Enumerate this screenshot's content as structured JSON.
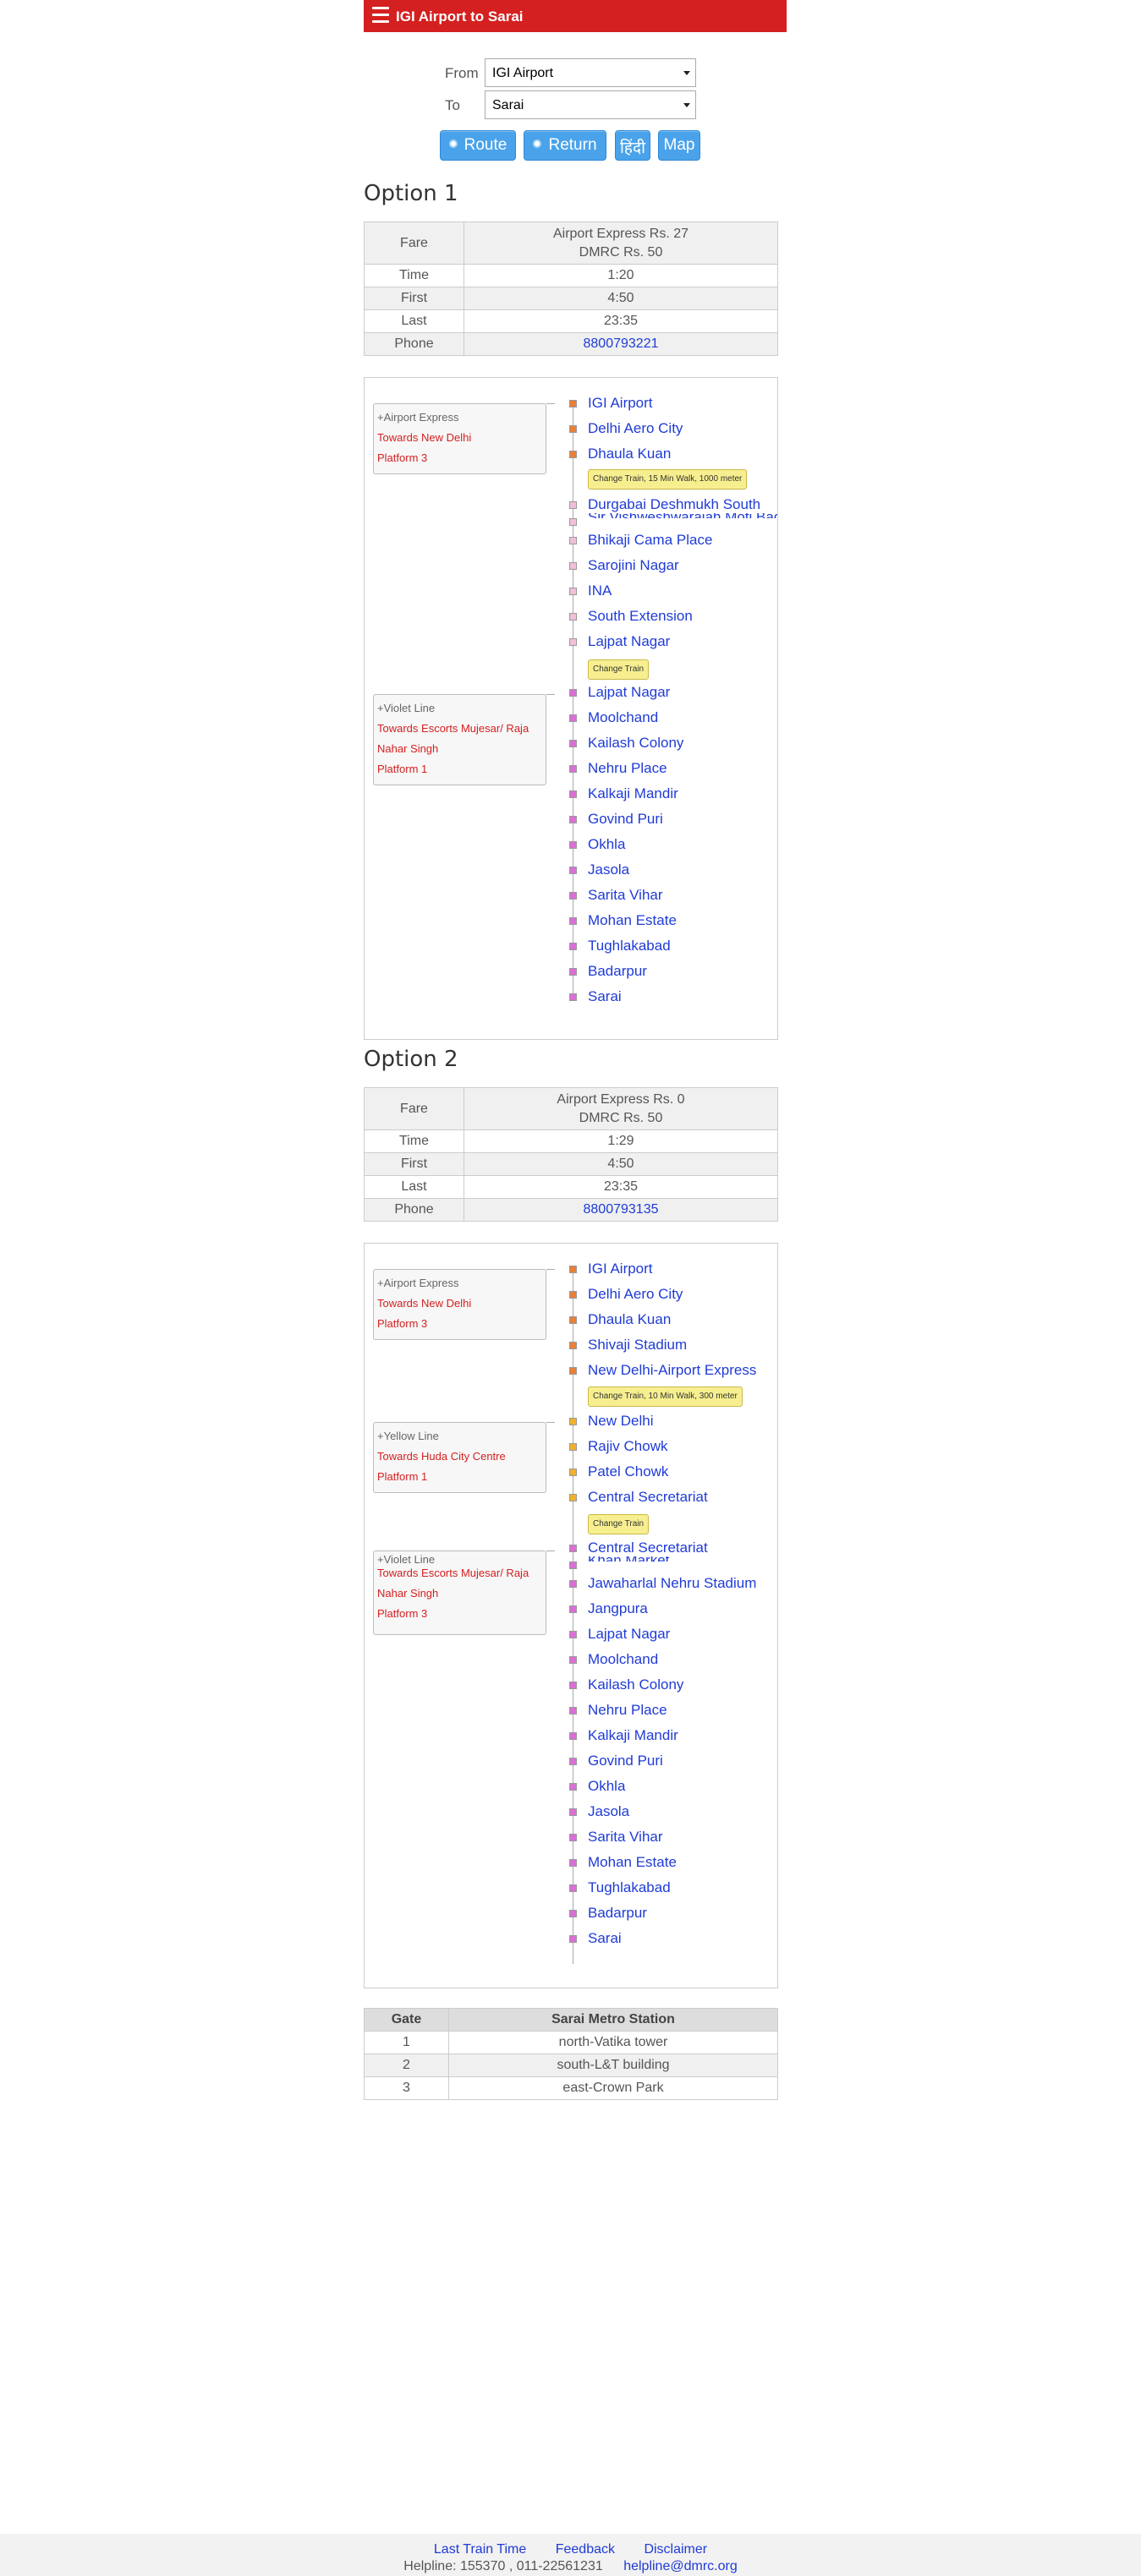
{
  "header": {
    "title": "IGI Airport to Sarai"
  },
  "form": {
    "from_label": "From",
    "from_value": "IGI Airport",
    "to_label": "To",
    "to_value": "Sarai",
    "buttons": {
      "route": "Route",
      "return": "Return",
      "hindi": "हिंदी",
      "map": "Map"
    }
  },
  "option1": {
    "heading": "Option 1",
    "fare_label": "Fare",
    "fare_line1": "Airport Express Rs. 27",
    "fare_line2": "DMRC Rs. 50",
    "rows": [
      {
        "label": "Time",
        "value": "1:20"
      },
      {
        "label": "First",
        "value": "4:50"
      },
      {
        "label": "Last",
        "value": "23:35"
      },
      {
        "label": "Phone",
        "value": "8800793221"
      }
    ],
    "lines": [
      {
        "name": "+Airport Express",
        "towards": "Towards New Delhi",
        "platform": "Platform 3"
      },
      {
        "name": "+Violet Line",
        "towards": "Towards Escorts Mujesar/ Raja Nahar Singh",
        "platform": "Platform 1"
      }
    ],
    "stations": [
      "IGI Airport",
      "Delhi Aero City",
      "Dhaula Kuan",
      "Durgabai Deshmukh South",
      "Sir Vishweshwaraiah Moti Bagh",
      "Bhikaji Cama Place",
      "Sarojini Nagar",
      "INA",
      "South Extension",
      "Lajpat Nagar",
      "Lajpat Nagar",
      "Moolchand",
      "Kailash Colony",
      "Nehru Place",
      "Kalkaji Mandir",
      "Govind Puri",
      "Okhla",
      "Jasola",
      "Sarita Vihar",
      "Mohan Estate",
      "Tughlakabad",
      "Badarpur",
      "Sarai"
    ],
    "tips": [
      "Change Train, 15 Min Walk, 1000 meter",
      "Change Train"
    ]
  },
  "option2": {
    "heading": "Option 2",
    "fare_label": "Fare",
    "fare_line1": "Airport Express Rs. 0",
    "fare_line2": "DMRC Rs. 50",
    "rows": [
      {
        "label": "Time",
        "value": "1:29"
      },
      {
        "label": "First",
        "value": "4:50"
      },
      {
        "label": "Last",
        "value": "23:35"
      },
      {
        "label": "Phone",
        "value": "8800793135"
      }
    ],
    "lines": [
      {
        "name": "+Airport Express",
        "towards": "Towards New Delhi",
        "platform": "Platform 3"
      },
      {
        "name": "+Yellow Line",
        "towards": "Towards Huda City Centre",
        "platform": "Platform 1"
      },
      {
        "name": "+Violet Line",
        "towards": "Towards Escorts Mujesar/ Raja Nahar Singh",
        "platform": "Platform 3"
      }
    ],
    "stations": [
      "IGI Airport",
      "Delhi Aero City",
      "Dhaula Kuan",
      "Shivaji Stadium",
      "New Delhi-Airport Express",
      "New Delhi",
      "Rajiv Chowk",
      "Patel Chowk",
      "Central Secretariat",
      "Central Secretariat",
      "Khan Market",
      "Jawaharlal Nehru Stadium",
      "Jangpura",
      "Lajpat Nagar",
      "Moolchand",
      "Kailash Colony",
      "Nehru Place",
      "Kalkaji Mandir",
      "Govind Puri",
      "Okhla",
      "Jasola",
      "Sarita Vihar",
      "Mohan Estate",
      "Tughlakabad",
      "Badarpur",
      "Sarai"
    ],
    "tips": [
      "Change Train, 10 Min Walk, 300 meter",
      "Change Train"
    ]
  },
  "gates": {
    "header_gate": "Gate",
    "header_station": "Sarai Metro Station",
    "rows": [
      {
        "gate": "1",
        "desc": "north-Vatika tower"
      },
      {
        "gate": "2",
        "desc": "south-L&T building"
      },
      {
        "gate": "3",
        "desc": "east-Crown Park"
      }
    ]
  },
  "footer": {
    "last_train": "Last Train Time",
    "feedback": "Feedback",
    "disclaimer": "Disclaimer",
    "helpline": "Helpline: 155370 , 011-22561231",
    "email": "helpline@dmrc.org"
  },
  "colors": {
    "header": "#d42020",
    "button": "#4aa3ea",
    "link": "#1f3bd6",
    "airport_express": "#e8803a",
    "violet": "#d970d6",
    "yellow": "#f0b030",
    "pink": "#f0c0d8",
    "tip": "#f7ef8f"
  }
}
